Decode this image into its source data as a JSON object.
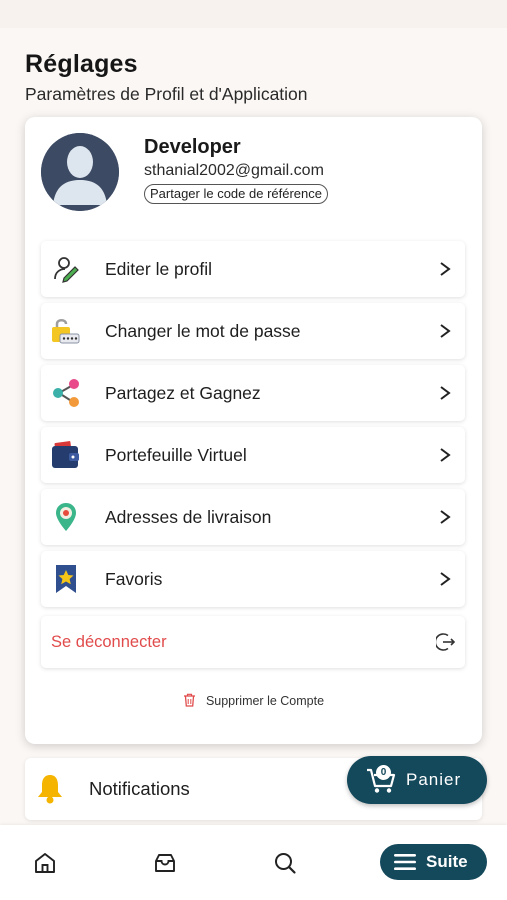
{
  "header": {
    "title": "Réglages",
    "subtitle": "Paramètres de Profil et d'Application"
  },
  "profile": {
    "name": "Developer",
    "email": "sthanial2002@gmail.com",
    "referral_button": "Partager le code de référence"
  },
  "menu": {
    "items": [
      {
        "label": "Editer le profil",
        "icon": "edit-profile-icon"
      },
      {
        "label": "Changer le mot de passe",
        "icon": "lock-password-icon"
      },
      {
        "label": "Partagez et Gagnez",
        "icon": "share-icon"
      },
      {
        "label": "Portefeuille Virtuel",
        "icon": "wallet-icon"
      },
      {
        "label": "Adresses de livraison",
        "icon": "location-pin-icon"
      },
      {
        "label": "Favoris",
        "icon": "favorite-star-icon"
      }
    ],
    "logout": "Se déconnecter",
    "delete_account": "Supprimer le Compte"
  },
  "notifications": {
    "label": "Notifications"
  },
  "cart": {
    "label": "Panier",
    "count": "0"
  },
  "bottom_nav": {
    "suite_label": "Suite"
  },
  "colors": {
    "brand": "#14485b",
    "danger": "#e14b4b",
    "background": "#fbf7f5"
  }
}
